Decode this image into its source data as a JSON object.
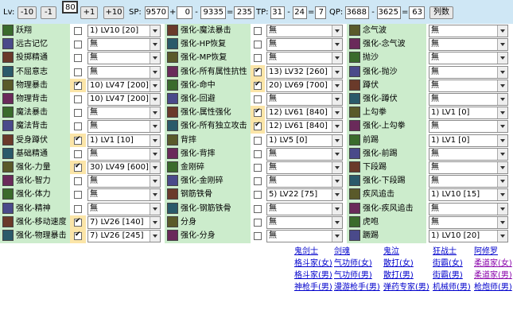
{
  "toolbar": {
    "lv_label": "Lv:",
    "btn_minus10": "-10",
    "btn_minus1": "-1",
    "lv_value": "80",
    "btn_plus1": "+1",
    "btn_plus10": "+10",
    "sp_label": "SP:",
    "sp_total": "9570",
    "sp_plus": "+",
    "sp_bonus": "0",
    "sp_minus": "-",
    "sp_used": "9335",
    "sp_eq": "=",
    "sp_left": "235",
    "tp_label": "TP:",
    "tp_total": "31",
    "tp_minus": "-",
    "tp_used": "24",
    "tp_eq": "=",
    "tp_left": "7",
    "qp_label": "QP:",
    "qp_total": "3688",
    "qp_minus": "-",
    "qp_used": "3625",
    "qp_eq": "=",
    "qp_left": "63",
    "list_button": "列数"
  },
  "rows": [
    {
      "a": {
        "name": "跃翔",
        "checked": false,
        "value": "1) LV10 [20]"
      },
      "b": {
        "name": "强化-魔法暴击",
        "checked": false,
        "value": "無"
      },
      "c": {
        "name": "念气波",
        "value": "無"
      }
    },
    {
      "a": {
        "name": "远古记忆",
        "checked": false,
        "value": "無"
      },
      "b": {
        "name": "强化-HP恢复",
        "checked": false,
        "value": "無"
      },
      "c": {
        "name": "强化-念气波",
        "value": "無"
      }
    },
    {
      "a": {
        "name": "投掷精通",
        "checked": false,
        "value": "無"
      },
      "b": {
        "name": "强化-MP恢复",
        "checked": false,
        "value": "無"
      },
      "c": {
        "name": "抛沙",
        "value": "無"
      }
    },
    {
      "a": {
        "name": "不屈意志",
        "checked": false,
        "value": "無"
      },
      "b": {
        "name": "强化-所有属性抗性",
        "checked": true,
        "value": "13) LV32 [260]"
      },
      "c": {
        "name": "强化-抛沙",
        "value": "無"
      }
    },
    {
      "a": {
        "name": "物理暴击",
        "checked": true,
        "value": "10) LV47 [200]"
      },
      "b": {
        "name": "强化-命中",
        "checked": true,
        "value": "20) LV69 [700]"
      },
      "c": {
        "name": "蹲伏",
        "value": "無"
      }
    },
    {
      "a": {
        "name": "物理背击",
        "checked": false,
        "value": "10) LV47 [200]"
      },
      "b": {
        "name": "强化-回避",
        "checked": false,
        "value": "無"
      },
      "c": {
        "name": "强化-蹲伏",
        "value": "無"
      }
    },
    {
      "a": {
        "name": "魔法暴击",
        "checked": false,
        "value": "無"
      },
      "b": {
        "name": "强化-属性强化",
        "checked": true,
        "value": "12) LV61 [840]"
      },
      "c": {
        "name": "上勾拳",
        "value": "1) LV1 [0]"
      }
    },
    {
      "a": {
        "name": "魔法背击",
        "checked": false,
        "value": "無"
      },
      "b": {
        "name": "强化-所有独立攻击",
        "checked": true,
        "value": "12) LV61 [840]"
      },
      "c": {
        "name": "强化-上勾拳",
        "value": "無"
      }
    },
    {
      "a": {
        "name": "受身蹲伏",
        "checked": true,
        "value": "1) LV1 [10]"
      },
      "b": {
        "name": "背摔",
        "checked": false,
        "value": "1) LV5 [0]"
      },
      "c": {
        "name": "前踢",
        "value": "1) LV1 [0]"
      }
    },
    {
      "a": {
        "name": "基础精通",
        "checked": false,
        "value": "無"
      },
      "b": {
        "name": "强化-背摔",
        "checked": false,
        "value": "無"
      },
      "c": {
        "name": "强化-前踢",
        "value": "無"
      }
    },
    {
      "a": {
        "name": "强化-力量",
        "checked": true,
        "value": "30) LV49 [600]"
      },
      "b": {
        "name": "金刚碎",
        "checked": false,
        "value": "無"
      },
      "c": {
        "name": "下段踢",
        "value": "無"
      }
    },
    {
      "a": {
        "name": "强化-智力",
        "checked": false,
        "value": "無"
      },
      "b": {
        "name": "强化-金刚碎",
        "checked": false,
        "value": "無"
      },
      "c": {
        "name": "强化-下段踢",
        "value": "無"
      }
    },
    {
      "a": {
        "name": "强化-体力",
        "checked": false,
        "value": "無"
      },
      "b": {
        "name": "钢筋铁骨",
        "checked": false,
        "value": "5) LV22 [75]"
      },
      "c": {
        "name": "疾风追击",
        "value": "1) LV10 [15]"
      }
    },
    {
      "a": {
        "name": "强化-精神",
        "checked": false,
        "value": "無"
      },
      "b": {
        "name": "强化-钢筋铁骨",
        "checked": false,
        "value": "無"
      },
      "c": {
        "name": "强化-疾风追击",
        "value": "無"
      }
    },
    {
      "a": {
        "name": "强化-移动速度",
        "checked": true,
        "value": "7) LV26 [140]"
      },
      "b": {
        "name": "分身",
        "checked": false,
        "value": "無"
      },
      "c": {
        "name": "虎咆",
        "value": "無"
      }
    },
    {
      "a": {
        "name": "强化-物理暴击",
        "checked": true,
        "value": "7) LV26 [245]"
      },
      "b": {
        "name": "强化-分身",
        "checked": false,
        "value": "無"
      },
      "c": {
        "name": "蹶踢",
        "value": "1) LV10 [20]"
      }
    }
  ],
  "links": [
    [
      "鬼剑士",
      "剑魂",
      "鬼泣",
      "狂战士",
      "阿修罗"
    ],
    [
      "格斗家(女)",
      "气功师(女)",
      "散打(女)",
      "街霸(女)",
      "柔道家(女)"
    ],
    [
      "格斗家(男)",
      "气功师(男)",
      "散打(男)",
      "街霸(男)",
      "柔道家(男)"
    ],
    [
      "神枪手(男)",
      "漫游枪手(男)",
      "弹药专家(男)",
      "机械师(男)",
      "枪炮师(男)"
    ]
  ],
  "colors": {
    "green": "#cceccc",
    "yellow": "#fbe5a8",
    "toolbar": "#cfe7f5",
    "link": "#0000cc",
    "link_visited": "#8800aa"
  }
}
